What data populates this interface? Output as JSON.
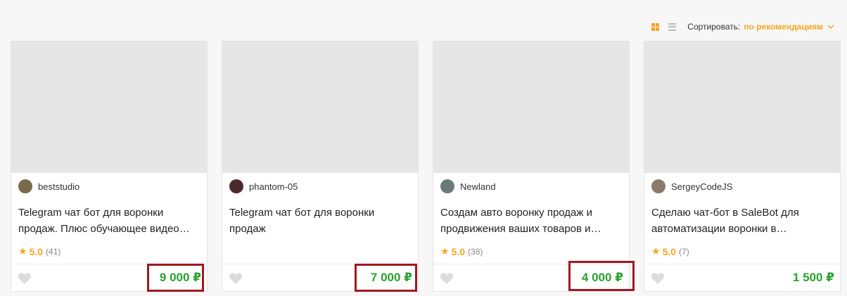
{
  "toolbar": {
    "sort_label": "Сортировать:",
    "sort_value": "по рекомендациям",
    "grid_view_icon": "grid-icon",
    "list_view_icon": "list-icon",
    "accent": "#f6a623"
  },
  "cards": [
    {
      "seller": "beststudio",
      "title": "Telegram чат бот для воронки продаж. Плюс обучающее видео…",
      "rating": "5.0",
      "reviews": "(41)",
      "price": "9 000 ₽",
      "highlighted": true,
      "avatar_color": "#7a6a4a"
    },
    {
      "seller": "phantom-05",
      "title": "Telegram чат бот для воронки продаж",
      "rating": "",
      "reviews": "",
      "price": "7 000 ₽",
      "highlighted": true,
      "avatar_color": "#4a2a2a"
    },
    {
      "seller": "Newland",
      "title": "Создам авто воронку продаж и продвижения ваших товаров и…",
      "rating": "5.0",
      "reviews": "(38)",
      "price": "4 000 ₽",
      "highlighted": true,
      "avatar_color": "#6a7a7a"
    },
    {
      "seller": "SergeyCodeJS",
      "title": "Сделаю чат-бот в SaleBot для автоматизации воронки в…",
      "rating": "5.0",
      "reviews": "(7)",
      "price": "1 500 ₽",
      "highlighted": false,
      "avatar_color": "#8a7a6a"
    }
  ],
  "colors": {
    "price": "#2aa12e",
    "highlight_border": "#a01820",
    "star": "#f6a623"
  }
}
